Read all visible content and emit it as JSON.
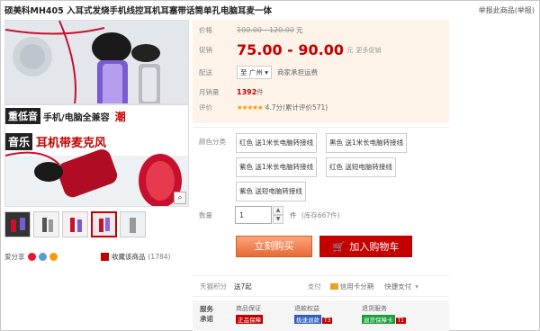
{
  "title": "硕美科MH405 入耳式发烧手机线控耳机耳塞带话筒单孔电脑耳麦一体",
  "report_link": "举报此商品(举报)",
  "main_image": {
    "banner_line1": "重低音",
    "banner_line1b": "手机/电脑全兼容",
    "banner_line1c": "潮",
    "banner_line2a": "音乐",
    "banner_line2b": "耳机带麦克风",
    "zoom_icon": "magnifier-icon"
  },
  "thumbnails_count": 5,
  "share_label": "爱分享",
  "favorite": {
    "label": "收藏该商品",
    "count": "(1784)"
  },
  "price": {
    "label": "价格",
    "original": "100.00 - 120.00",
    "original_unit": "元",
    "promo_label": "促销",
    "promo": "75.00 - 90.00",
    "promo_unit": "元",
    "more": "更多促销"
  },
  "delivery": {
    "label": "配送",
    "location": "至 广州 ▾",
    "note": "商家承担运费"
  },
  "sales": {
    "label": "月销量",
    "value": "1392",
    "unit": "件"
  },
  "rating": {
    "label": "评价",
    "stars": "★★★★★",
    "score": "4.7分",
    "count_text": "(累计评价571)"
  },
  "color": {
    "label": "颜色分类",
    "options": [
      "红色 送1米长电脑转接线",
      "黑色 送1米长电脑转接线",
      "紫色 送1米长电脑转接线",
      "红色 送短电脑转接线",
      "紫色 送短电脑转接线"
    ]
  },
  "quantity": {
    "label": "数量",
    "value": "1",
    "unit": "件",
    "stock": "(库存667件)"
  },
  "buttons": {
    "buy_now": "立刻购买",
    "add_cart": "加入购物车"
  },
  "bottom": {
    "points_label": "天猫积分",
    "points_value": "送7起",
    "pay_label": "支付",
    "credit": "信用卡分期",
    "quick_pay": "快捷支付",
    "quick_pay_arrow": "▾"
  },
  "service": {
    "label1": "服务",
    "label2": "承诺",
    "cols": [
      {
        "title": "商品保证",
        "badge": "正品保障",
        "badge_color": "#c40000",
        "t": ""
      },
      {
        "title": "退款权益",
        "badge": "极速退款",
        "badge_color": "#2f5dbf",
        "t": "T3"
      },
      {
        "title": "退货服务",
        "badge": "退货保障卡",
        "badge_color": "#1a9e3b",
        "t": "T1"
      }
    ]
  },
  "colors": {
    "accent": "#c40000",
    "orange": "#e5511d",
    "star": "#ff9800"
  }
}
